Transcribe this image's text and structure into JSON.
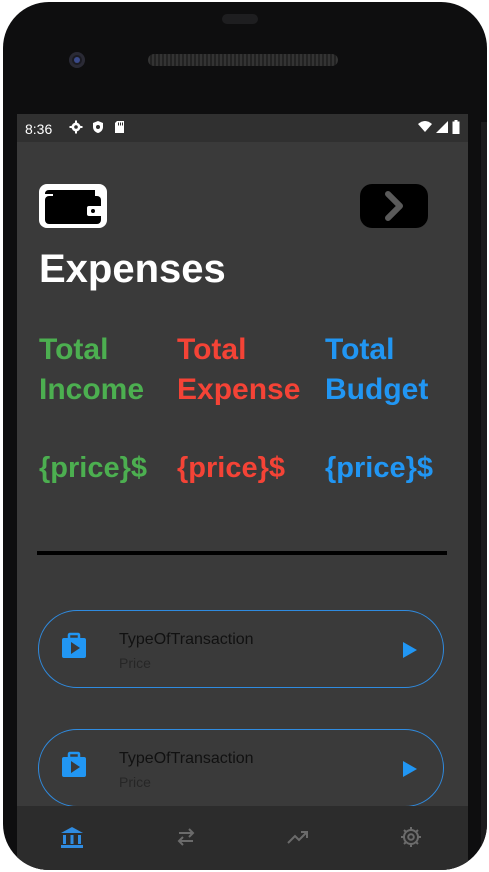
{
  "status_bar": {
    "time": "8:36"
  },
  "page": {
    "title": "Expenses"
  },
  "stats": [
    {
      "label": "Total Income",
      "value": "{price}$",
      "color": "#4caf50"
    },
    {
      "label": "Total Expense",
      "value": "{price}$",
      "color": "#f44336"
    },
    {
      "label": "Total Budget",
      "value": "{price}$",
      "color": "#2196f3"
    }
  ],
  "transactions": [
    {
      "type": "TypeOfTransaction",
      "price": "Price"
    },
    {
      "type": "TypeOfTransaction",
      "price": "Price"
    }
  ],
  "icons": {
    "header_left": "wallet-icon",
    "header_right": "chevron-right-icon",
    "transaction": "briefcase-play-icon",
    "transaction_action": "play-arrow-icon",
    "nav": [
      "bank-icon",
      "swap-icon",
      "trending-up-icon",
      "gear-icon"
    ]
  },
  "colors": {
    "accent": "#2196f3",
    "screen_bg": "#3a3a3a",
    "nav_bg": "#2c2c2c"
  }
}
